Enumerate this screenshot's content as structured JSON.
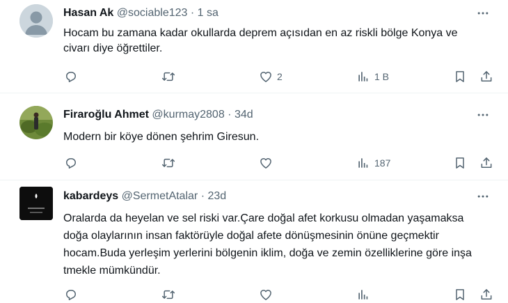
{
  "tweets": [
    {
      "name": "Hasan Ak",
      "handle": "@sociable123",
      "dot": "·",
      "time": "1 sa",
      "text": "Hocam bu zamana kadar okullarda   deprem açısıdan en az riskli bölge Konya  ve civarı diye öğrettiler.",
      "likes": "2",
      "views": "1 B"
    },
    {
      "name": "Firaroğlu Ahmet",
      "handle": "@kurmay2808",
      "dot": "·",
      "time": "34d",
      "text": "Modern bir köye dönen şehrim Giresun.",
      "likes": "",
      "views": "187"
    },
    {
      "name": "kabardeys",
      "handle": "@SermetAtalar",
      "dot": "·",
      "time": "23d",
      "text": "Oralarda da heyelan ve sel riski var.Çare doğal afet korkusu olmadan yaşamaksa doğa olaylarının insan faktörüyle doğal afete dönüşmesinin önüne geçmektir hocam.Buda yerleşim yerlerini bölgenin iklim, doğa ve zemin özelliklerine göre inşa tmekle mümkündür.",
      "likes": "",
      "views": ""
    }
  ],
  "colors": {
    "text": "#0f1419",
    "muted": "#536471",
    "divider": "#eff3f4"
  },
  "icons": [
    "reply-icon",
    "retweet-icon",
    "like-icon",
    "views-icon",
    "bookmark-icon",
    "share-icon",
    "more-icon"
  ]
}
